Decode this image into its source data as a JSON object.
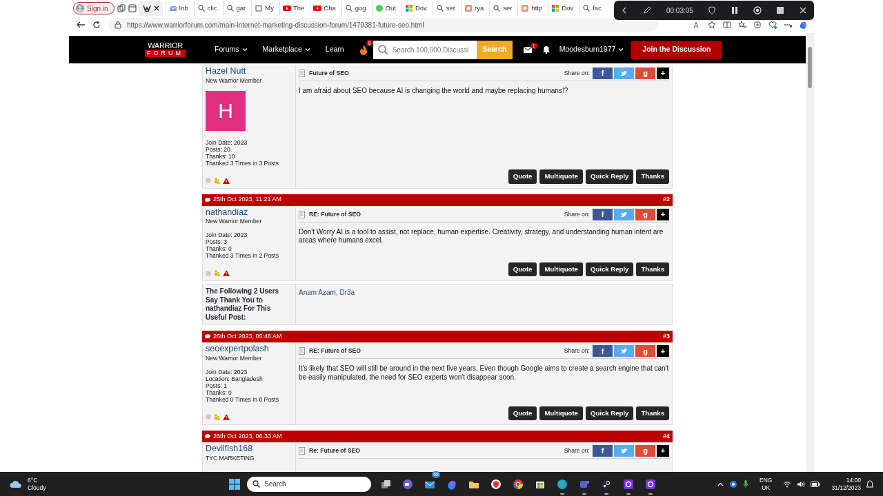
{
  "browser": {
    "profile_button": "Sign in",
    "tabs": [
      {
        "selected": true,
        "kind": "warrior"
      },
      {
        "label": "Inb",
        "selected": false,
        "kind": "mail"
      },
      {
        "label": "clic",
        "selected": false,
        "kind": "search"
      },
      {
        "label": "gar",
        "selected": false,
        "kind": "search"
      },
      {
        "label": "My",
        "selected": false,
        "kind": "web"
      },
      {
        "label": "The",
        "selected": false,
        "kind": "video"
      },
      {
        "label": "Cha",
        "selected": false,
        "kind": "video"
      },
      {
        "label": "gog",
        "selected": false,
        "kind": "search"
      },
      {
        "label": "Out",
        "selected": false,
        "kind": "globe"
      },
      {
        "label": "Dov",
        "selected": false,
        "kind": "windows"
      },
      {
        "label": "ser",
        "selected": false,
        "kind": "search"
      },
      {
        "label": "rya",
        "selected": false,
        "kind": "orange"
      },
      {
        "label": "ser",
        "selected": false,
        "kind": "search"
      },
      {
        "label": "http",
        "selected": false,
        "kind": "orange"
      },
      {
        "label": "Dov",
        "selected": false,
        "kind": "windows"
      },
      {
        "label": "fac",
        "selected": false,
        "kind": "search"
      }
    ],
    "url": "https://www.warriorforum.com/main-internet-marketing-discussion-forum/1479381-future-seo.html"
  },
  "recorder": {
    "time": "00:03:05"
  },
  "site_nav": {
    "logo_top": "WARRIOR",
    "logo_bottom": "FORUM",
    "menu": [
      {
        "label": "Forums",
        "dropdown": true
      },
      {
        "label": "Marketplace",
        "dropdown": true
      },
      {
        "label": "Learn",
        "dropdown": false
      }
    ],
    "hot_count": "8",
    "search_placeholder": "Search 100,000 Discussi",
    "search_button": "Search",
    "message_count": "1",
    "username": "Moodesburn1977",
    "join_button": "Join the Discussion"
  },
  "thread": [
    {
      "kind": "post",
      "user": "Hazel Nutt",
      "user_title": "New Warrior Member",
      "avatar": {
        "letter": "H",
        "color": "#e0307f"
      },
      "info": [
        "Join Date: 2023",
        "Posts: 20",
        "Thanks: 10",
        "Thanked 3 Times in 3 Posts"
      ],
      "subject": "Future of SEO",
      "share_label": "Share on:",
      "share": [
        {
          "kind": "facebook",
          "glyph": "f"
        },
        {
          "kind": "twitter"
        },
        {
          "kind": "google",
          "glyph": "g"
        },
        {
          "kind": "more",
          "glyph": "+"
        }
      ],
      "body": "I am afraid about SEO because AI is changing the world and maybe replacing humans!?",
      "actions": [
        "Quote",
        "Multiquote",
        "Quick Reply",
        "Thanks"
      ]
    },
    {
      "kind": "post",
      "date": "25th Oct 2023, 11:21 AM",
      "number": "#2",
      "user": "nathandiaz",
      "user_title": "New Warrior Member",
      "info": [
        "Join Date: 2023",
        "Posts: 3",
        "Thanks: 0",
        "Thanked 3 Times in 2 Posts"
      ],
      "subject": "RE: Future of SEO",
      "share_label": "Share on:",
      "share": [
        {
          "kind": "facebook",
          "glyph": "f"
        },
        {
          "kind": "twitter"
        },
        {
          "kind": "google",
          "glyph": "g"
        },
        {
          "kind": "more",
          "glyph": "+"
        }
      ],
      "body": "Don't Worry AI is a tool to assist, not replace, human expertise. Creativity, strategy, and understanding human intent are areas where humans excel.",
      "actions": [
        "Quote",
        "Multiquote",
        "Quick Reply",
        "Thanks"
      ]
    },
    {
      "kind": "thanks",
      "heading": "The Following 2 Users Say Thank You to nathandiaz For This Useful Post:",
      "users": [
        "Anam Azam",
        "Dr3a"
      ],
      "separator": ","
    },
    {
      "kind": "post",
      "date": "26th Oct 2023, 05:48 AM",
      "number": "#3",
      "user": "seoexpertpolash",
      "user_title": "New Warrior Member",
      "info": [
        "Join Date: 2023",
        "Location: Bangladesh",
        "Posts: 1",
        "Thanks: 0",
        "Thanked 0 Times in 0 Posts"
      ],
      "subject": "RE: Future of SEO",
      "share_label": "Share on:",
      "share": [
        {
          "kind": "facebook",
          "glyph": "f"
        },
        {
          "kind": "twitter"
        },
        {
          "kind": "google",
          "glyph": "g"
        },
        {
          "kind": "more",
          "glyph": "+"
        }
      ],
      "body": "It's likely that SEO will still be around in the next five years. Even though Google aims to create a search engine that can't be easily manipulated, the need for SEO experts won't disappear soon.",
      "actions": [
        "Quote",
        "Multiquote",
        "Quick Reply",
        "Thanks"
      ]
    },
    {
      "kind": "post",
      "date": "26th Oct 2023, 06:33 AM",
      "number": "#4",
      "user": "Devilfish168",
      "user_title": "TYC MARKETING",
      "subject": "Re: Future of SEO",
      "share_label": "Share on:",
      "share": [
        {
          "kind": "facebook",
          "glyph": "f"
        },
        {
          "kind": "twitter"
        },
        {
          "kind": "google",
          "glyph": "g"
        },
        {
          "kind": "more",
          "glyph": "+"
        }
      ]
    }
  ],
  "taskbar": {
    "temperature": "6°C",
    "weather": "Cloudy",
    "search": "Search",
    "apps": [
      {
        "kind": "taskview",
        "running": false
      },
      {
        "kind": "meet",
        "running": false
      },
      {
        "kind": "mail",
        "badge": "58",
        "running": false
      },
      {
        "kind": "copilot",
        "running": false
      },
      {
        "kind": "folder",
        "running": false
      },
      {
        "kind": "shield",
        "running": false
      },
      {
        "kind": "chrome",
        "running": false
      },
      {
        "kind": "store",
        "running": false
      },
      {
        "kind": "edge",
        "running": true
      },
      {
        "kind": "teams",
        "running": true
      },
      {
        "kind": "steam",
        "running": true
      },
      {
        "kind": "purple",
        "running": true
      },
      {
        "kind": "purple",
        "running": true
      }
    ],
    "language": "ENG",
    "region": "UK",
    "time": "14:00",
    "date": "31/12/2023"
  }
}
